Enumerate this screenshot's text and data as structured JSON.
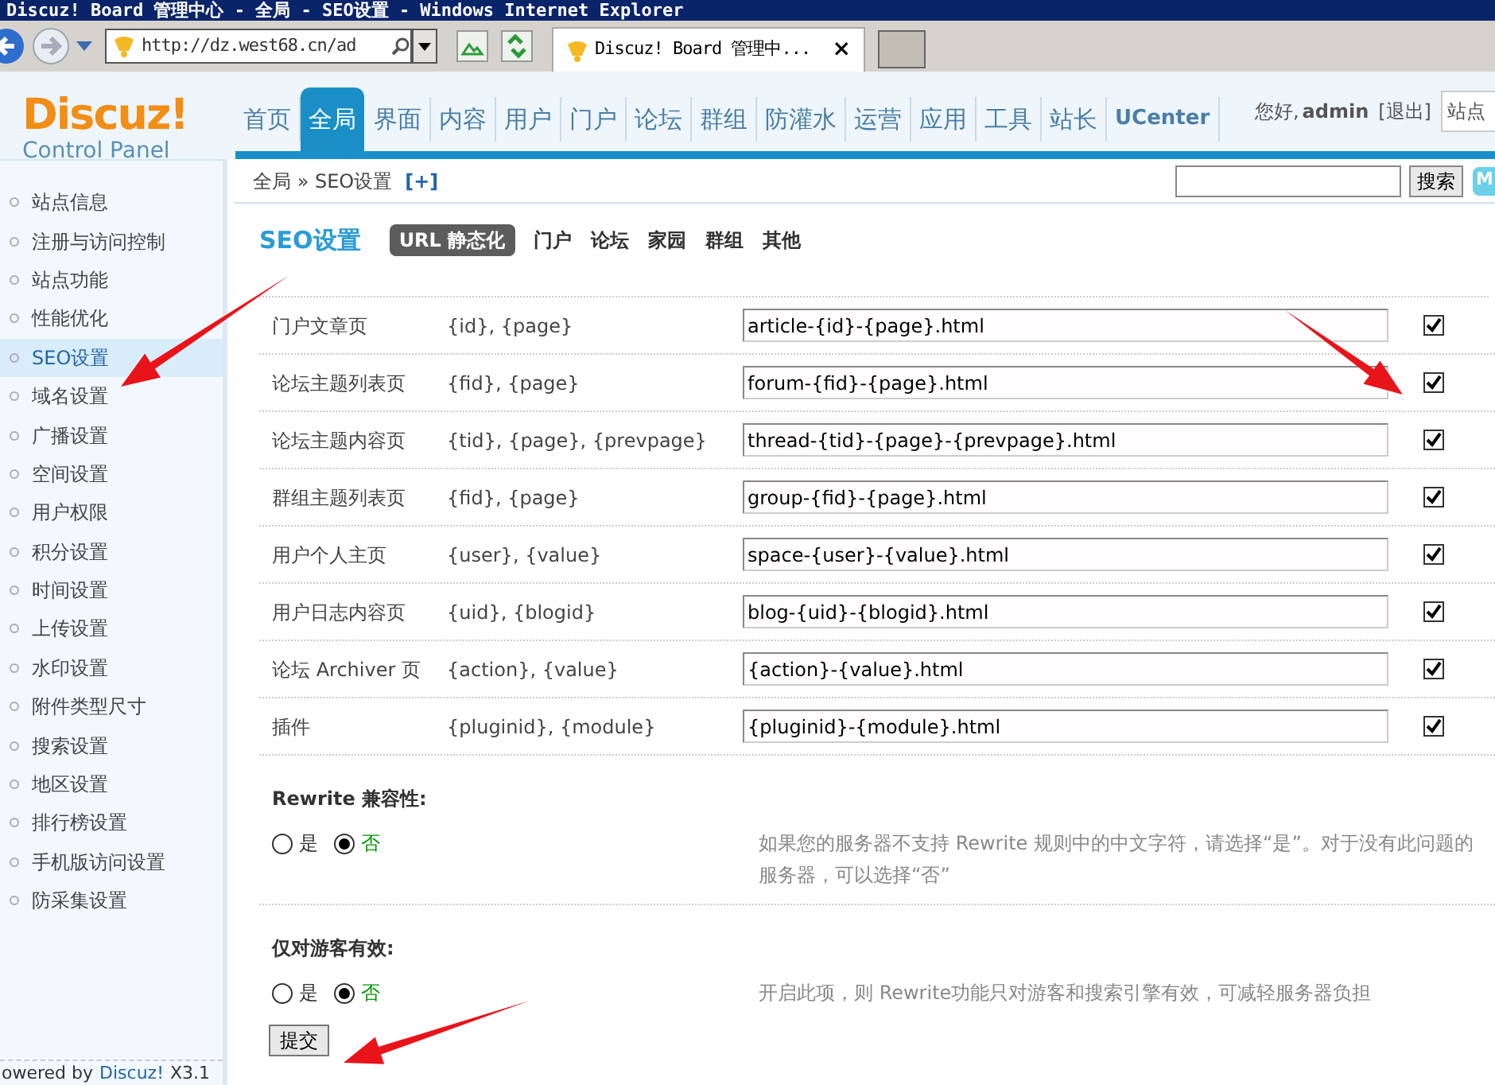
{
  "window": {
    "title": "Discuz! Board 管理中心 - 全局 - SEO设置 - Windows Internet Explorer"
  },
  "browser": {
    "address": "http://dz.west68.cn/ad",
    "tab_title": "Discuz! Board 管理中...",
    "tab_close": "×"
  },
  "header": {
    "logo_title": "Discuz!",
    "logo_subtitle": "Control Panel",
    "nav": [
      {
        "label": "首页",
        "selected": false
      },
      {
        "label": "全局",
        "selected": true
      },
      {
        "label": "界面",
        "selected": false
      },
      {
        "label": "内容",
        "selected": false
      },
      {
        "label": "用户",
        "selected": false
      },
      {
        "label": "门户",
        "selected": false
      },
      {
        "label": "论坛",
        "selected": false
      },
      {
        "label": "群组",
        "selected": false
      },
      {
        "label": "防灌水",
        "selected": false
      },
      {
        "label": "运营",
        "selected": false
      },
      {
        "label": "应用",
        "selected": false
      },
      {
        "label": "工具",
        "selected": false
      },
      {
        "label": "站长",
        "selected": false
      },
      {
        "label": "UCenter",
        "selected": false
      }
    ],
    "greeting": "您好,",
    "user": "admin",
    "logout": "[退出]",
    "site_field": "站点"
  },
  "breadcrumb": {
    "path": "全局 » SEO设置",
    "expand": "[+]",
    "search_button": "搜索",
    "badge": "M"
  },
  "sidebar": {
    "items": [
      {
        "label": "站点信息",
        "selected": false
      },
      {
        "label": "注册与访问控制",
        "selected": false
      },
      {
        "label": "站点功能",
        "selected": false
      },
      {
        "label": "性能优化",
        "selected": false
      },
      {
        "label": "SEO设置",
        "selected": true
      },
      {
        "label": "域名设置",
        "selected": false
      },
      {
        "label": "广播设置",
        "selected": false
      },
      {
        "label": "空间设置",
        "selected": false
      },
      {
        "label": "用户权限",
        "selected": false
      },
      {
        "label": "积分设置",
        "selected": false
      },
      {
        "label": "时间设置",
        "selected": false
      },
      {
        "label": "上传设置",
        "selected": false
      },
      {
        "label": "水印设置",
        "selected": false
      },
      {
        "label": "附件类型尺寸",
        "selected": false
      },
      {
        "label": "搜索设置",
        "selected": false
      },
      {
        "label": "地区设置",
        "selected": false
      },
      {
        "label": "排行榜设置",
        "selected": false
      },
      {
        "label": "手机版访问设置",
        "selected": false
      },
      {
        "label": "防采集设置",
        "selected": false
      }
    ],
    "footer_prefix": "owered by",
    "footer_link": "Discuz!",
    "footer_version": "X3.1"
  },
  "content": {
    "title": "SEO设置",
    "tabs": [
      {
        "label": "URL 静态化",
        "selected": true
      },
      {
        "label": "门户",
        "selected": false
      },
      {
        "label": "论坛",
        "selected": false
      },
      {
        "label": "家园",
        "selected": false
      },
      {
        "label": "群组",
        "selected": false
      },
      {
        "label": "其他",
        "selected": false
      }
    ],
    "rules": [
      {
        "page": "门户文章页",
        "variables": "{id}, {page}",
        "format": "article-{id}-{page}.html",
        "checked": true
      },
      {
        "page": "论坛主题列表页",
        "variables": "{fid}, {page}",
        "format": "forum-{fid}-{page}.html",
        "checked": true
      },
      {
        "page": "论坛主题内容页",
        "variables": "{tid}, {page}, {prevpage}",
        "format": "thread-{tid}-{page}-{prevpage}.html",
        "checked": true
      },
      {
        "page": "群组主题列表页",
        "variables": "{fid}, {page}",
        "format": "group-{fid}-{page}.html",
        "checked": true
      },
      {
        "page": "用户个人主页",
        "variables": "{user}, {value}",
        "format": "space-{user}-{value}.html",
        "checked": true
      },
      {
        "page": "用户日志内容页",
        "variables": "{uid}, {blogid}",
        "format": "blog-{uid}-{blogid}.html",
        "checked": true
      },
      {
        "page": "论坛 Archiver 页",
        "variables": "{action}, {value}",
        "format": "{action}-{value}.html",
        "checked": true
      },
      {
        "page": "插件",
        "variables": "{pluginid}, {module}",
        "format": "{pluginid}-{module}.html",
        "checked": true
      }
    ],
    "settings": [
      {
        "label": "Rewrite 兼容性:",
        "options": [
          {
            "label": "是",
            "selected": false
          },
          {
            "label": "否",
            "selected": true
          }
        ],
        "hint": "如果您的服务器不支持 Rewrite 规则中的中文字符，请选择“是”。对于没有此问题的服务器，可以选择“否”"
      },
      {
        "label": "仅对游客有效:",
        "options": [
          {
            "label": "是",
            "selected": false
          },
          {
            "label": "否",
            "selected": true
          }
        ],
        "hint": "开启此项，则 Rewrite功能只对游客和搜索引擎有效，可减轻服务器负担"
      }
    ],
    "submit": "提交"
  }
}
